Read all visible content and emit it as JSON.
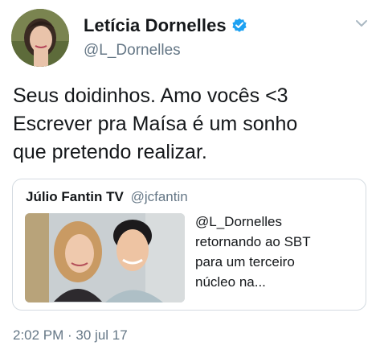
{
  "author": {
    "display_name": "Letícia Dornelles",
    "handle": "@L_Dornelles",
    "verified": true,
    "avatar_icon": "profile-photo"
  },
  "tweet": {
    "lines": [
      "Seus doidinhos. Amo vocês <3",
      "Escrever pra Maísa é um sonho",
      "que pretendo realizar."
    ],
    "timestamp": "2:02 PM · 30 jul 17"
  },
  "quoted_tweet": {
    "display_name": "Júlio Fantin TV",
    "handle": "@jcfantin",
    "text_lines": [
      "@L_Dornelles",
      "retornando ao SBT",
      "para um terceiro",
      "núcleo na..."
    ],
    "image_icon": "photo-thumbnail"
  },
  "colors": {
    "text": "#14171a",
    "secondary": "#657786",
    "verified": "#1da1f2",
    "border": "#d4dbe1"
  },
  "icons": {
    "verified": "verified-badge-icon",
    "menu": "chevron-down-icon"
  }
}
